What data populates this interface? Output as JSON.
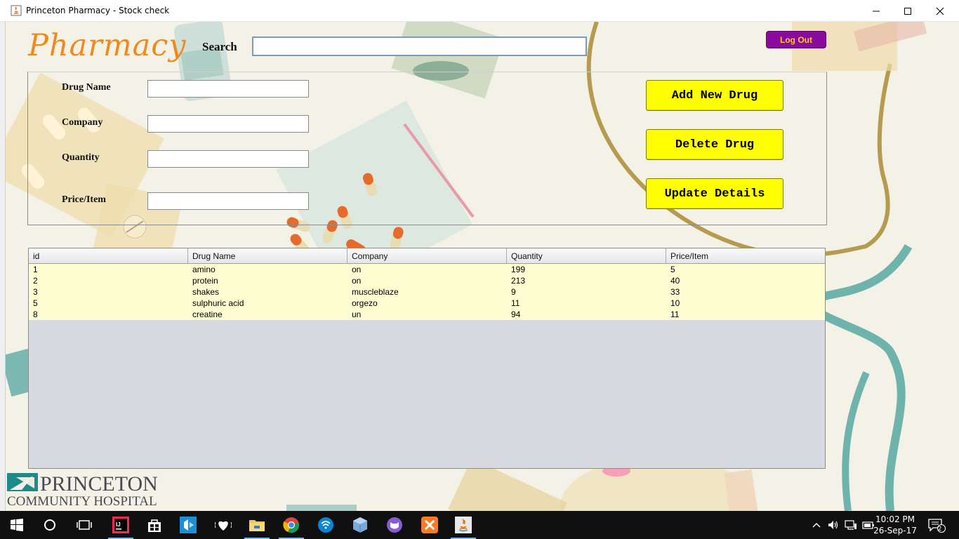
{
  "window": {
    "title": "Princeton Pharmacy - Stock check",
    "controls": [
      "minimize",
      "maximize",
      "close"
    ]
  },
  "header": {
    "app_title": "Pharmacy",
    "search_label": "Search",
    "search_value": "",
    "logout_label": "Log Out"
  },
  "form": {
    "fields": [
      {
        "label": "Drug Name",
        "value": ""
      },
      {
        "label": "Company",
        "value": ""
      },
      {
        "label": "Quantity",
        "value": ""
      },
      {
        "label": "Price/Item",
        "value": ""
      }
    ],
    "buttons": {
      "add": "Add New Drug",
      "delete": "Delete Drug",
      "update": "Update Details"
    }
  },
  "table": {
    "columns": [
      "id",
      "Drug Name",
      "Company",
      "Quantity",
      "Price/Item"
    ],
    "rows": [
      [
        "1",
        "amino",
        "on",
        "199",
        "5"
      ],
      [
        "2",
        "protein",
        "on",
        "213",
        "40"
      ],
      [
        "3",
        "shakes",
        "muscleblaze",
        "9",
        "33"
      ],
      [
        "5",
        "sulphuric acid",
        "orgezo",
        "11",
        "10"
      ],
      [
        "8",
        "creatine",
        "un",
        "94",
        "11"
      ]
    ]
  },
  "logo": {
    "line1": "PRINCETON",
    "line2": "COMMUNITY HOSPITAL"
  },
  "taskbar": {
    "apps": [
      "start-icon",
      "cortana-icon",
      "task-view-icon",
      "intellij-icon",
      "store-icon",
      "media-icon",
      "iheart-icon",
      "file-explorer-icon",
      "chrome-icon",
      "wifi-app-icon",
      "box-icon",
      "cat-app-icon",
      "xampp-icon",
      "java-icon"
    ],
    "time": "10:02 PM",
    "date": "26-Sep-17",
    "notification_count": "2"
  },
  "colors": {
    "title_orange": "#f08a1d",
    "button_yellow": "#ffff00",
    "logout_purple": "#8a0a9e",
    "logout_text": "#f4d200",
    "table_row": "#fffdd2",
    "table_empty": "#d6d9e0"
  }
}
